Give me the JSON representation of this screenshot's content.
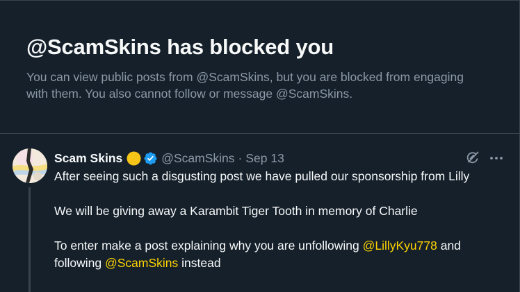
{
  "block_notice": {
    "title": "@ScamSkins has blocked you",
    "description": "You can view public posts from @ScamSkins, but you are blocked from engaging with them. You also cannot follow or message @ScamSkins."
  },
  "post": {
    "display_name": "Scam Skins",
    "handle": "@ScamSkins",
    "separator": "·",
    "date": "Sep 13",
    "paragraphs": {
      "p1": "After seeing such a disgusting post we have pulled our sponsorship from Lilly",
      "p2": "We will be giving away a Karambit Tiger Tooth in memory of Charlie",
      "p3_before": "To enter make a post explaining why you are unfollowing ",
      "p3_mention1": "@LillyKyu778",
      "p3_middle": " and following ",
      "p3_mention2": "@ScamSkins",
      "p3_after": " instead"
    }
  },
  "icons": {
    "badge": "gold-circle-icon",
    "verified": "verified-badge-icon",
    "grok": "grok-icon",
    "more": "more-options-icon"
  },
  "colors": {
    "background": "#15202b",
    "text": "#f7f9f9",
    "muted": "#8b98a5",
    "border": "#38444d",
    "mention": "#ffd400",
    "verified": "#1d9bf0",
    "gold": "#f5c518"
  }
}
